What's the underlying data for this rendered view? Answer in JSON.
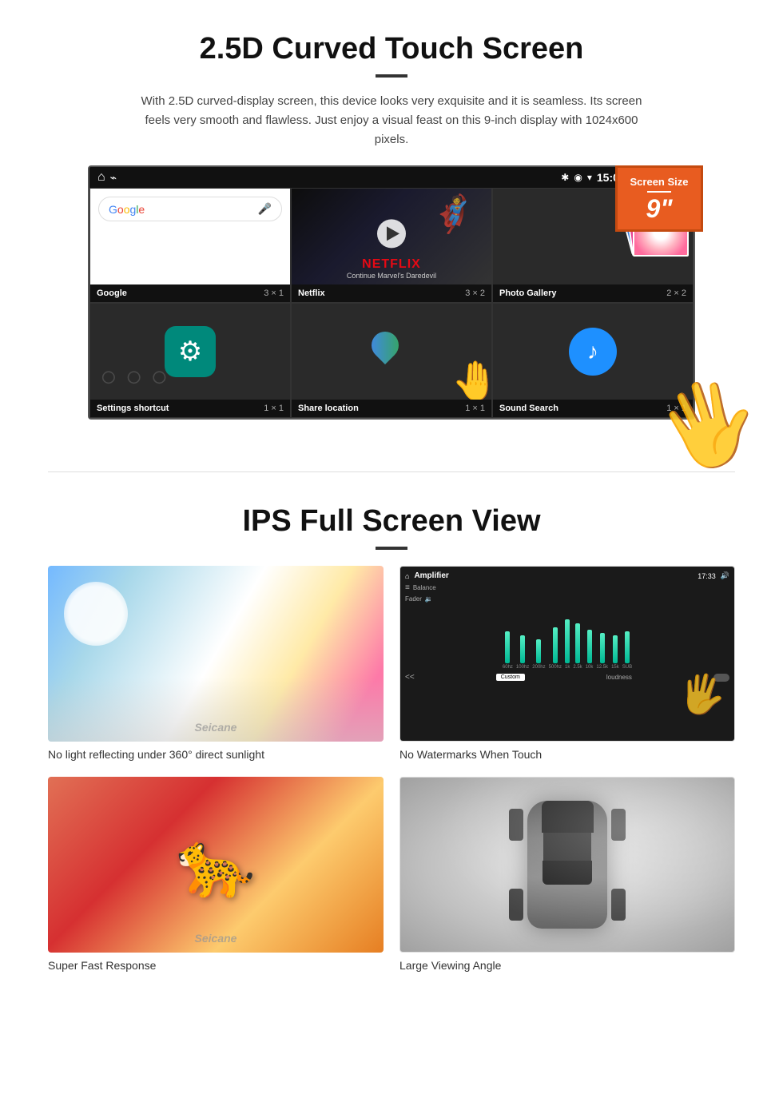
{
  "section1": {
    "title": "2.5D Curved Touch Screen",
    "description": "With 2.5D curved-display screen, this device looks very exquisite and it is seamless. Its screen feels very smooth and flawless. Just enjoy a visual feast on this 9-inch display with 1024x600 pixels.",
    "badge": {
      "title": "Screen Size",
      "size": "9\""
    },
    "statusBar": {
      "time": "15:06"
    },
    "apps": [
      {
        "name": "Google",
        "grid": "3 × 1"
      },
      {
        "name": "Netflix",
        "grid": "3 × 2",
        "netflix_text": "NETFLIX",
        "netflix_sub": "Continue Marvel's Daredevil"
      },
      {
        "name": "Photo Gallery",
        "grid": "2 × 2"
      },
      {
        "name": "Settings shortcut",
        "grid": "1 × 1"
      },
      {
        "name": "Share location",
        "grid": "1 × 1"
      },
      {
        "name": "Sound Search",
        "grid": "1 × 1"
      }
    ]
  },
  "section2": {
    "title": "IPS Full Screen View",
    "cards": [
      {
        "caption": "No light reflecting under 360° direct sunlight"
      },
      {
        "caption": "No Watermarks When Touch"
      },
      {
        "caption": "Super Fast Response"
      },
      {
        "caption": "Large Viewing Angle"
      }
    ],
    "amplifier": {
      "title": "Amplifier",
      "time": "17:33",
      "eq_labels": [
        "60hz",
        "100hz",
        "200hz",
        "500hz",
        "1k",
        "2.5k",
        "10k",
        "12.5k",
        "15k",
        "SUB"
      ],
      "eq_heights": [
        40,
        35,
        30,
        45,
        55,
        50,
        42,
        38,
        35,
        40
      ],
      "footer_left": "loudness",
      "footer_btn": "Custom"
    }
  },
  "watermark": "Seicane"
}
